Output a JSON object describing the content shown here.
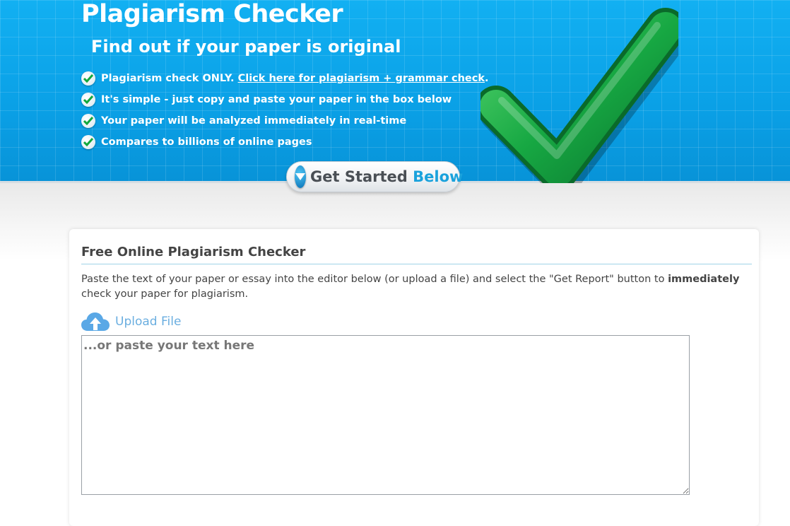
{
  "hero": {
    "title": "Plagiarism Checker",
    "subtitle": "Find out if your paper is original",
    "features": [
      {
        "text": "Plagiarism check ONLY. ",
        "link": "Click here for plagiarism + grammar check",
        "after": "."
      },
      {
        "text": "It's simple - just copy and paste your paper in the box below"
      },
      {
        "text": "Your paper will be analyzed immediately in real-time"
      },
      {
        "text": "Compares to billions of online pages"
      }
    ],
    "get_started": {
      "main": "Get Started ",
      "accent": "Below"
    }
  },
  "checker": {
    "title": "Free Online Plagiarism Checker",
    "description_before": "Paste the text of your paper or essay into the editor below (or upload a file) and select the \"Get Report\" button to ",
    "description_bold": "immediately",
    "description_after": " check your paper for plagiarism.",
    "upload_label": "Upload File",
    "editor_placeholder": "...or paste your text here",
    "editor_value": ""
  },
  "colors": {
    "hero_blue": "#0b9ee3",
    "check_green": "#12a83c",
    "link_blue": "#6aaee0",
    "accent_blue": "#1aa2dc"
  },
  "icons": {
    "feature": "green-check-icon",
    "big": "big-checkmark-icon",
    "get_started": "down-arrow-icon",
    "upload": "cloud-upload-icon"
  }
}
